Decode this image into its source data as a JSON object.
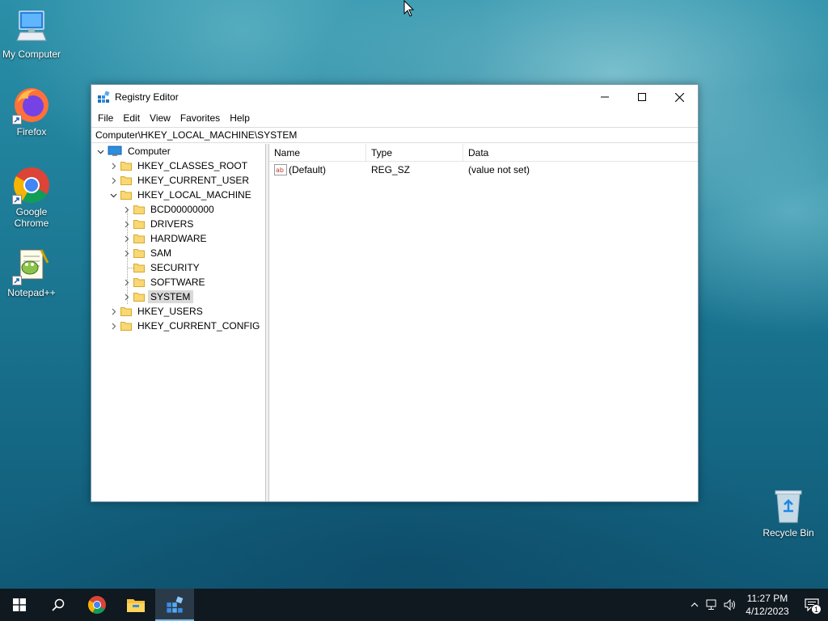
{
  "desktop": {
    "icons": [
      {
        "label": "My Computer",
        "icon": "my-computer-icon"
      },
      {
        "label": "Firefox",
        "icon": "firefox-icon"
      },
      {
        "label": "Google Chrome",
        "icon": "chrome-icon"
      },
      {
        "label": "Notepad++",
        "icon": "notepad-plus-plus-icon"
      },
      {
        "label": "Recycle Bin",
        "icon": "recycle-bin-icon"
      }
    ]
  },
  "window": {
    "title": "Registry Editor",
    "menu": [
      "File",
      "Edit",
      "View",
      "Favorites",
      "Help"
    ],
    "address": "Computer\\HKEY_LOCAL_MACHINE\\SYSTEM",
    "tree": {
      "root": "Computer",
      "hives": [
        "HKEY_CLASSES_ROOT",
        "HKEY_CURRENT_USER",
        "HKEY_LOCAL_MACHINE",
        "HKEY_USERS",
        "HKEY_CURRENT_CONFIG"
      ],
      "hklm_children": [
        "BCD00000000",
        "DRIVERS",
        "HARDWARE",
        "SAM",
        "SECURITY",
        "SOFTWARE",
        "SYSTEM"
      ],
      "selected": "SYSTEM"
    },
    "columns": [
      "Name",
      "Type",
      "Data"
    ],
    "values": [
      {
        "name": "(Default)",
        "type": "REG_SZ",
        "data": "(value not set)",
        "icon": "string-value-icon"
      }
    ]
  },
  "taskbar": {
    "buttons": [
      "start-icon",
      "search-icon",
      "chrome-icon",
      "file-explorer-icon",
      "registry-editor-icon"
    ],
    "active": "registry-editor-icon",
    "time": "11:27 PM",
    "date": "4/12/2023",
    "notification_count": "1"
  },
  "colors": {
    "taskbar": "#101820",
    "active_accent": "#76b9ed",
    "selection": "#d9d9d9",
    "folder": "#f8d775"
  }
}
